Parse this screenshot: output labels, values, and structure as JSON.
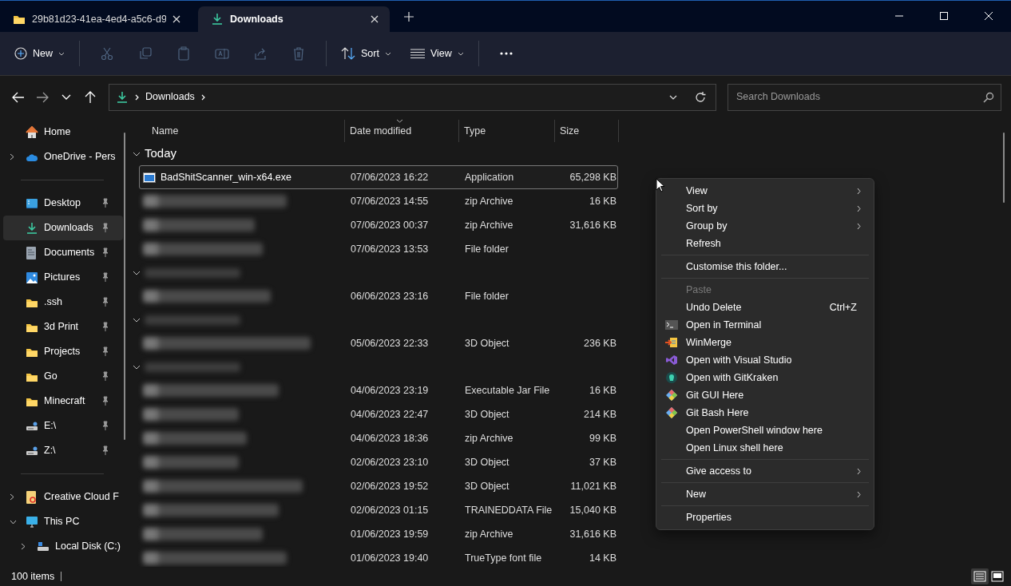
{
  "tabs": [
    {
      "label": "29b81d23-41ea-4ed4-a5c6-d9",
      "kind": "folder",
      "selected": false
    },
    {
      "label": "Downloads",
      "kind": "downloads",
      "selected": true
    }
  ],
  "toolbar": {
    "new_label": "New",
    "icon_buttons": [
      {
        "kind": "cut",
        "disabled": true
      },
      {
        "kind": "copy",
        "disabled": true
      },
      {
        "kind": "paste",
        "disabled": true
      },
      {
        "kind": "rename",
        "disabled": true
      },
      {
        "kind": "share",
        "disabled": true
      },
      {
        "kind": "delete",
        "disabled": true
      }
    ],
    "sort_label": "Sort",
    "view_label": "View"
  },
  "address": {
    "breadcrumbs": [
      "Downloads"
    ],
    "search_placeholder": "Search Downloads"
  },
  "sidebar": {
    "sections": [
      [
        {
          "label": "Home",
          "kind": "home",
          "pinned": false,
          "selected": false
        },
        {
          "label": "OneDrive - Pers",
          "kind": "cloud",
          "pinned": false,
          "selected": false,
          "expanded": false
        }
      ],
      [
        {
          "label": "Desktop",
          "kind": "desktop",
          "pinned": true,
          "selected": false
        },
        {
          "label": "Downloads",
          "kind": "downloads",
          "pinned": true,
          "selected": true
        },
        {
          "label": "Documents",
          "kind": "documents",
          "pinned": true,
          "selected": false
        },
        {
          "label": "Pictures",
          "kind": "pictures",
          "pinned": true,
          "selected": false
        },
        {
          "label": ".ssh",
          "kind": "folder",
          "pinned": true,
          "selected": false
        },
        {
          "label": "3d Print",
          "kind": "folder",
          "pinned": true,
          "selected": false
        },
        {
          "label": "Projects",
          "kind": "folder",
          "pinned": true,
          "selected": false
        },
        {
          "label": "Go",
          "kind": "folder",
          "pinned": true,
          "selected": false
        },
        {
          "label": "Minecraft",
          "kind": "folder",
          "pinned": true,
          "selected": false
        },
        {
          "label": "E:\\",
          "kind": "drive",
          "pinned": true,
          "selected": false
        },
        {
          "label": "Z:\\",
          "kind": "drive",
          "pinned": true,
          "selected": false
        }
      ],
      [
        {
          "label": "Creative Cloud F",
          "kind": "app",
          "pinned": false,
          "selected": false,
          "expanded": false
        },
        {
          "label": "This PC",
          "kind": "pc",
          "pinned": false,
          "selected": false,
          "expanded": true,
          "children": [
            {
              "label": "Local Disk (C:)",
              "kind": "disk",
              "pinned": false,
              "selected": false,
              "expanded": false
            }
          ]
        }
      ]
    ]
  },
  "file_list": {
    "columns": [
      {
        "label": "Name",
        "sorted": false
      },
      {
        "label": "Date modified",
        "sorted": true
      },
      {
        "label": "Type",
        "sorted": false
      },
      {
        "label": "Size",
        "sorted": false
      }
    ],
    "items": [
      {
        "kind": "group",
        "label": "Today",
        "expanded": true
      },
      {
        "kind": "file",
        "name": "BadShitScanner_win-x64.exe",
        "date": "07/06/2023 16:22",
        "type": "Application",
        "size": "65,298 KB",
        "focused": true
      },
      {
        "kind": "file",
        "date": "07/06/2023 14:55",
        "type": "zip Archive",
        "size": "16 KB",
        "focused": false
      },
      {
        "kind": "file",
        "date": "07/06/2023 00:37",
        "type": "zip Archive",
        "size": "31,616 KB",
        "focused": false
      },
      {
        "kind": "file",
        "date": "07/06/2023 13:53",
        "type": "File folder",
        "focused": false
      },
      {
        "kind": "group",
        "expanded": true
      },
      {
        "kind": "file",
        "date": "06/06/2023 23:16",
        "type": "File folder",
        "focused": false
      },
      {
        "kind": "group",
        "expanded": true
      },
      {
        "kind": "file",
        "date": "05/06/2023 22:33",
        "type": "3D Object",
        "size": "236 KB",
        "focused": false
      },
      {
        "kind": "group",
        "expanded": true
      },
      {
        "kind": "file",
        "date": "04/06/2023 23:19",
        "type": "Executable Jar File",
        "size": "16 KB",
        "focused": false
      },
      {
        "kind": "file",
        "date": "04/06/2023 22:47",
        "type": "3D Object",
        "size": "214 KB",
        "focused": false
      },
      {
        "kind": "file",
        "date": "04/06/2023 18:36",
        "type": "zip Archive",
        "size": "99 KB",
        "focused": false
      },
      {
        "kind": "file",
        "date": "02/06/2023 23:10",
        "type": "3D Object",
        "size": "37 KB",
        "focused": false
      },
      {
        "kind": "file",
        "date": "02/06/2023 19:52",
        "type": "3D Object",
        "size": "11,021 KB",
        "focused": false
      },
      {
        "kind": "file",
        "date": "02/06/2023 01:15",
        "type": "TRAINEDDATA File",
        "size": "15,040 KB",
        "focused": false
      },
      {
        "kind": "file",
        "date": "01/06/2023 19:59",
        "type": "zip Archive",
        "size": "31,616 KB",
        "focused": false
      },
      {
        "kind": "file",
        "date": "01/06/2023 19:40",
        "type": "TrueType font file",
        "size": "14 KB",
        "focused": false
      }
    ]
  },
  "context_menu": {
    "sections": [
      [
        {
          "label": "View",
          "kind": "plain",
          "submenu": true,
          "disabled": false
        },
        {
          "label": "Sort by",
          "kind": "plain",
          "submenu": true,
          "disabled": false
        },
        {
          "label": "Group by",
          "kind": "plain",
          "submenu": true,
          "disabled": false
        },
        {
          "label": "Refresh",
          "kind": "plain",
          "submenu": false,
          "disabled": false
        }
      ],
      [
        {
          "label": "Customise this folder...",
          "kind": "plain",
          "submenu": false,
          "disabled": false
        }
      ],
      [
        {
          "label": "Paste",
          "kind": "plain",
          "submenu": false,
          "disabled": true
        },
        {
          "label": "Undo Delete",
          "shortcut": "Ctrl+Z",
          "kind": "plain",
          "submenu": false,
          "disabled": false
        },
        {
          "label": "Open in Terminal",
          "kind": "terminal",
          "submenu": false,
          "disabled": false
        },
        {
          "label": "WinMerge",
          "kind": "winmerge",
          "submenu": false,
          "disabled": false
        },
        {
          "label": "Open with Visual Studio",
          "kind": "studio",
          "submenu": false,
          "disabled": false
        },
        {
          "label": "Open with GitKraken",
          "kind": "kraken",
          "submenu": false,
          "disabled": false
        },
        {
          "label": "Git GUI Here",
          "kind": "git",
          "submenu": false,
          "disabled": false
        },
        {
          "label": "Git Bash Here",
          "kind": "git",
          "submenu": false,
          "disabled": false
        },
        {
          "label": "Open PowerShell window here",
          "kind": "plain",
          "submenu": false,
          "disabled": false
        },
        {
          "label": "Open Linux shell here",
          "kind": "plain",
          "submenu": false,
          "disabled": false
        }
      ],
      [
        {
          "label": "Give access to",
          "kind": "plain",
          "submenu": true,
          "disabled": false
        }
      ],
      [
        {
          "label": "New",
          "kind": "plain",
          "submenu": true,
          "disabled": false
        }
      ],
      [
        {
          "label": "Properties",
          "kind": "plain",
          "submenu": false,
          "disabled": false
        }
      ]
    ]
  },
  "status_bar": {
    "count": "100 items",
    "view_modes": [
      {
        "kind": "details",
        "selected": true
      },
      {
        "kind": "tiles",
        "selected": false
      }
    ]
  }
}
